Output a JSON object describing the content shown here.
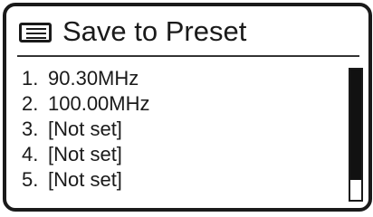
{
  "header": {
    "icon": "menu-list-icon",
    "title": "Save to Preset"
  },
  "presets": [
    {
      "number": "1.",
      "label": "90.30MHz"
    },
    {
      "number": "2.",
      "label": "100.00MHz"
    },
    {
      "number": "3.",
      "label": "[Not set]"
    },
    {
      "number": "4.",
      "label": "[Not set]"
    },
    {
      "number": "5.",
      "label": "[Not set]"
    }
  ],
  "scrollbar": {
    "visible_fraction": 0.85
  }
}
